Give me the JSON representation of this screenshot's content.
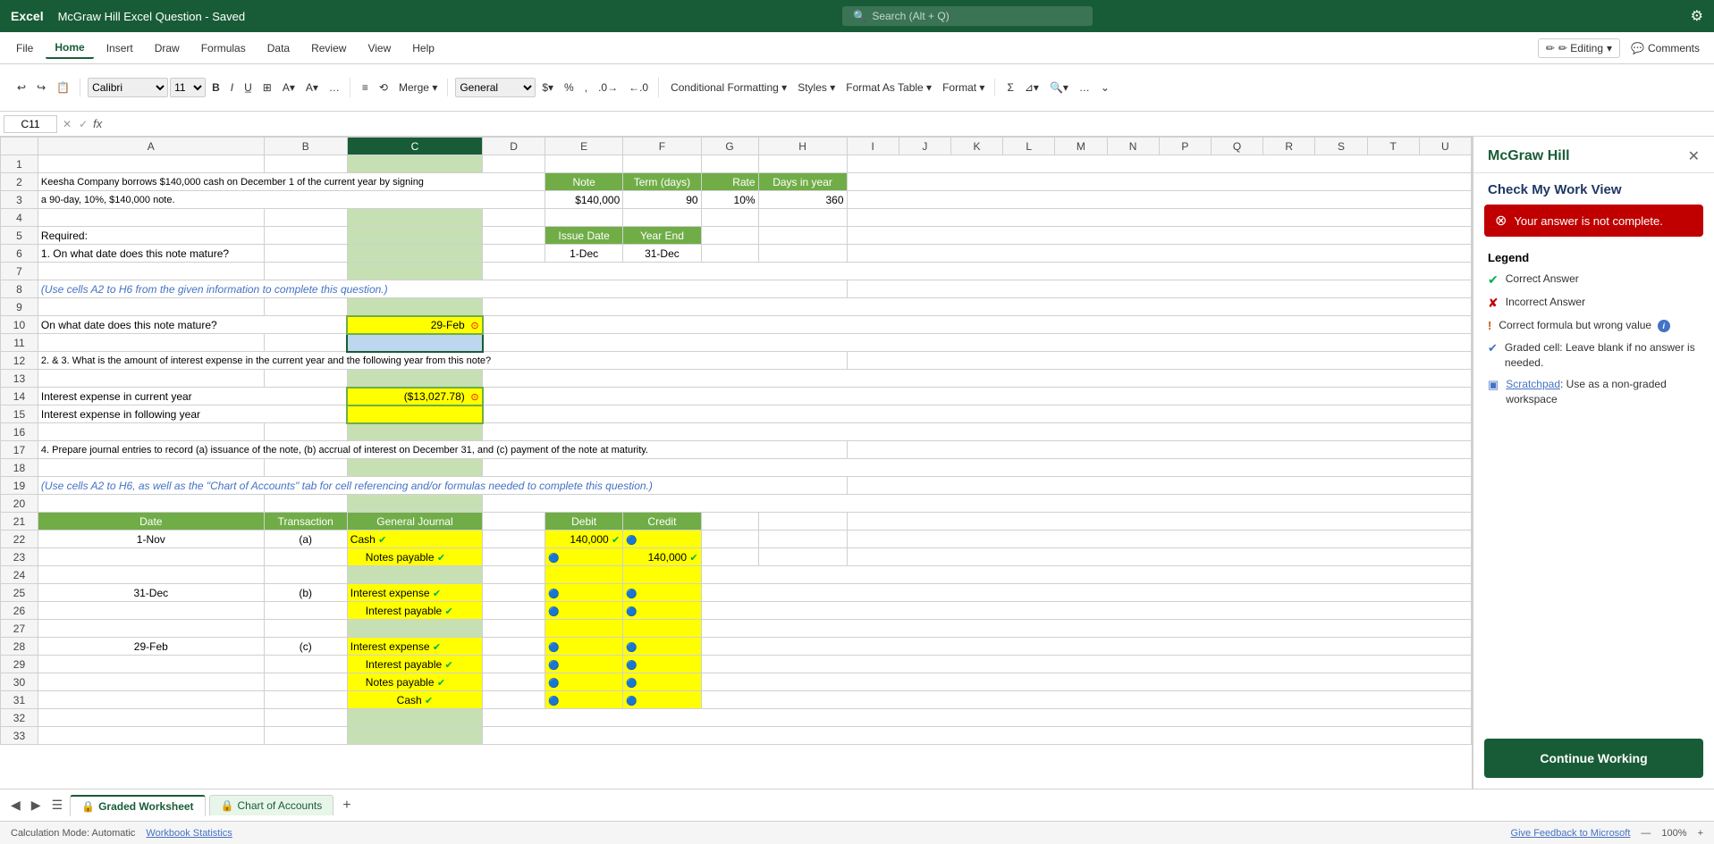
{
  "titlebar": {
    "app": "Excel",
    "doc": "McGraw Hill Excel Question - Saved",
    "search_placeholder": "Search (Alt + Q)",
    "settings_label": "⚙"
  },
  "ribbon": {
    "tabs": [
      "File",
      "Home",
      "Insert",
      "Draw",
      "Formulas",
      "Data",
      "Review",
      "View",
      "Help"
    ],
    "active_tab": "Home",
    "editing_label": "✏ Editing",
    "comments_label": "💬 Comments"
  },
  "formula_bar": {
    "cell_ref": "C11",
    "fx": "fx"
  },
  "spreadsheet": {
    "col_headers": [
      "",
      "A",
      "B",
      "C",
      "D",
      "E",
      "F",
      "G",
      "H",
      "I",
      "J",
      "K",
      "L",
      "M",
      "N",
      "P",
      "Q",
      "R",
      "S",
      "T",
      "U"
    ],
    "rows": []
  },
  "right_panel": {
    "title": "McGraw Hill",
    "subtitle": "Check My Work View",
    "close_label": "✕",
    "error_msg": "Your answer is not complete.",
    "legend_title": "Legend",
    "legend_items": [
      {
        "icon": "✔",
        "color": "green",
        "text": "Correct Answer"
      },
      {
        "icon": "✘",
        "color": "red",
        "text": "Incorrect Answer"
      },
      {
        "icon": "!",
        "color": "orange",
        "text": "Correct formula but wrong value"
      },
      {
        "icon": "✔",
        "color": "blue",
        "text": "Graded cell: Leave blank if no answer is needed."
      },
      {
        "icon": "□",
        "color": "blue",
        "text_prefix": "Scratchpad",
        "text_suffix": ": Use as a non-graded workspace"
      }
    ],
    "continue_label": "Continue Working"
  },
  "bottom": {
    "tabs": [
      {
        "label": "Graded Worksheet",
        "active": true
      },
      {
        "label": "Chart of Accounts",
        "active": false
      }
    ],
    "add_label": "+"
  },
  "status_bar": {
    "left": "Calculation Mode: Automatic",
    "middle": "Workbook Statistics",
    "right_feedback": "Give Feedback to Microsoft",
    "zoom": "100%"
  }
}
